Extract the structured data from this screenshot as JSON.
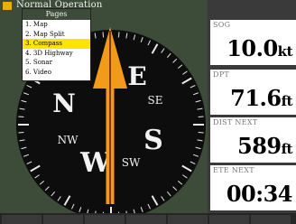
{
  "title": "Normal Operation",
  "menu": {
    "header": "Pages",
    "items": [
      "1. Map",
      "2. Map Split",
      "3. Compass",
      "4. 3D Highway",
      "5. Sonar",
      "6. Video"
    ],
    "selected_index": 2
  },
  "compass": {
    "labels": {
      "e": "E",
      "se": "SE",
      "s": "S",
      "sw": "SW",
      "w": "W",
      "nw": "NW",
      "n": "N"
    }
  },
  "fields": [
    {
      "label": "SOG",
      "value": "10.0",
      "unit": "kt"
    },
    {
      "label": "DPT",
      "value": "71.6",
      "unit": "ft"
    },
    {
      "label": "DIST NEXT",
      "value": "589",
      "unit": "ft"
    },
    {
      "label": "ETE NEXT",
      "value": "00:34",
      "unit": ""
    }
  ],
  "colors": {
    "background": "#3c4c38",
    "dial": "#0d0d0d",
    "arrow": "#f29a1a",
    "highlight": "#ffe400"
  }
}
